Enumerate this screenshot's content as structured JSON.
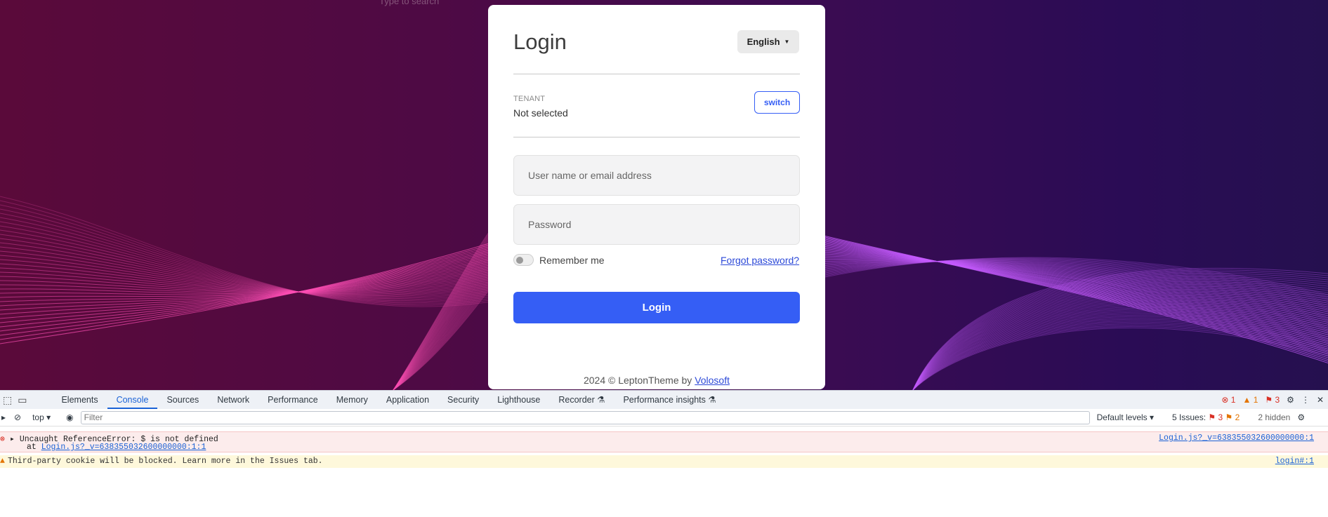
{
  "background": {
    "caption": "Type to search"
  },
  "login": {
    "title": "Login",
    "language": "English",
    "tenant_label": "TENANT",
    "tenant_value": "Not selected",
    "switch_label": "switch",
    "username_placeholder": "User name or email address",
    "password_placeholder": "Password",
    "remember_label": "Remember me",
    "forgot_label": "Forgot password?",
    "submit_label": "Login",
    "footer_text": "2024 © LeptonTheme by",
    "footer_link": "Volosoft"
  },
  "colors": {
    "primary": "#355ef5",
    "bg_left": "#5a0a3a",
    "bg_right": "#25104f",
    "wave_pink": "#ff4fb5",
    "wave_violet": "#c65cff"
  },
  "devtools": {
    "tabs": [
      "Elements",
      "Console",
      "Sources",
      "Network",
      "Performance",
      "Memory",
      "Application",
      "Security",
      "Lighthouse",
      "Recorder ⚗",
      "Performance insights ⚗"
    ],
    "active_tab": "Console",
    "error_count": "1",
    "warning_count": "1",
    "issue_count": "3",
    "context": "top",
    "filter_placeholder": "Filter",
    "levels": "Default levels",
    "issues_label": "5 Issues:",
    "issues_errors": "3",
    "issues_warnings": "2",
    "hidden": "2 hidden",
    "error_msg": "Uncaught ReferenceError: $ is not defined",
    "error_at": "at",
    "error_link": "Login.js?_v=638355032600000000:1:1",
    "error_source": "Login.js?_v=638355032600000000:1",
    "warn_msg": "Third-party cookie will be blocked. Learn more in the Issues tab.",
    "warn_source": "login#:1"
  }
}
